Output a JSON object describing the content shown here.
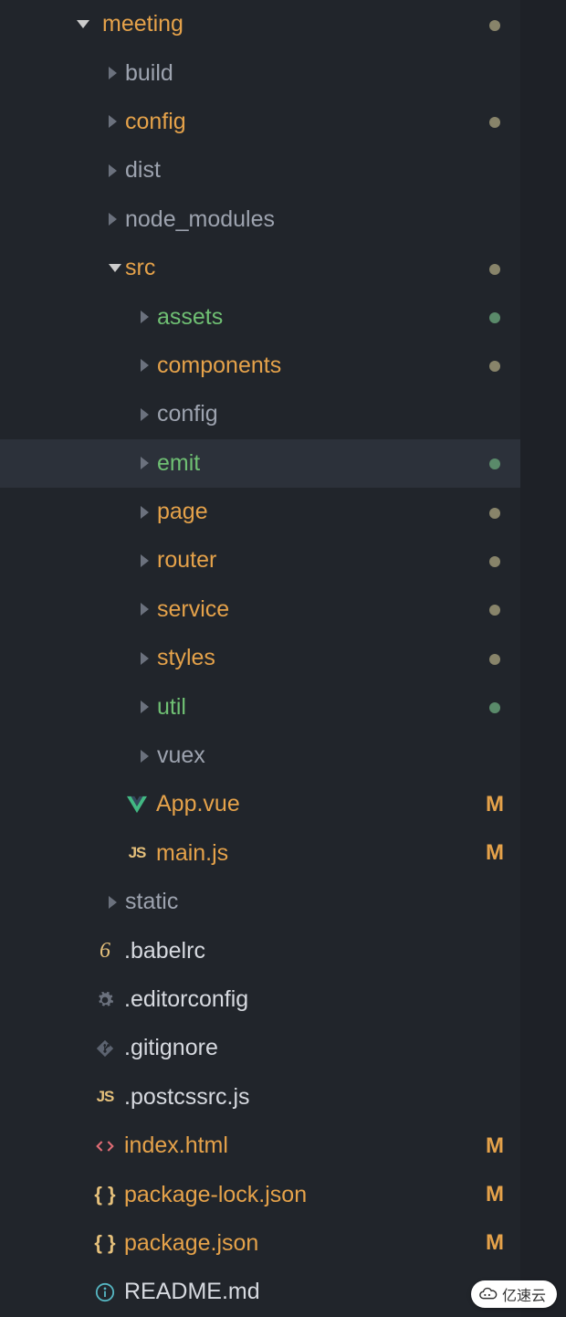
{
  "root": {
    "label": "meeting",
    "expanded": true,
    "status": "dot-tan"
  },
  "tree": [
    {
      "level": 1,
      "type": "folder",
      "label": "build",
      "color": "grey",
      "expanded": false,
      "status": ""
    },
    {
      "level": 1,
      "type": "folder",
      "label": "config",
      "color": "orange",
      "expanded": false,
      "status": "dot-tan"
    },
    {
      "level": 1,
      "type": "folder",
      "label": "dist",
      "color": "grey",
      "expanded": false,
      "status": ""
    },
    {
      "level": 1,
      "type": "folder",
      "label": "node_modules",
      "color": "grey",
      "expanded": false,
      "status": ""
    },
    {
      "level": 1,
      "type": "folder",
      "label": "src",
      "color": "orange",
      "expanded": true,
      "status": "dot-tan"
    },
    {
      "level": 2,
      "type": "folder",
      "label": "assets",
      "color": "green",
      "expanded": false,
      "status": "dot-green"
    },
    {
      "level": 2,
      "type": "folder",
      "label": "components",
      "color": "orange",
      "expanded": false,
      "status": "dot-tan"
    },
    {
      "level": 2,
      "type": "folder",
      "label": "config",
      "color": "grey",
      "expanded": false,
      "status": ""
    },
    {
      "level": 2,
      "type": "folder",
      "label": "emit",
      "color": "green",
      "expanded": false,
      "status": "dot-green",
      "selected": true
    },
    {
      "level": 2,
      "type": "folder",
      "label": "page",
      "color": "orange",
      "expanded": false,
      "status": "dot-tan"
    },
    {
      "level": 2,
      "type": "folder",
      "label": "router",
      "color": "orange",
      "expanded": false,
      "status": "dot-tan"
    },
    {
      "level": 2,
      "type": "folder",
      "label": "service",
      "color": "orange",
      "expanded": false,
      "status": "dot-tan"
    },
    {
      "level": 2,
      "type": "folder",
      "label": "styles",
      "color": "orange",
      "expanded": false,
      "status": "dot-tan"
    },
    {
      "level": 2,
      "type": "folder",
      "label": "util",
      "color": "green",
      "expanded": false,
      "status": "dot-green"
    },
    {
      "level": 2,
      "type": "folder",
      "label": "vuex",
      "color": "grey",
      "expanded": false,
      "status": ""
    },
    {
      "level": 2,
      "type": "file",
      "label": "App.vue",
      "color": "orange",
      "icon": "vue",
      "status": "M"
    },
    {
      "level": 2,
      "type": "file",
      "label": "main.js",
      "color": "orange",
      "icon": "js",
      "status": "M"
    },
    {
      "level": 1,
      "type": "folder",
      "label": "static",
      "color": "grey",
      "expanded": false,
      "status": ""
    },
    {
      "level": 1,
      "type": "file",
      "label": ".babelrc",
      "color": "white",
      "icon": "babel",
      "status": ""
    },
    {
      "level": 1,
      "type": "file",
      "label": ".editorconfig",
      "color": "white",
      "icon": "gear",
      "status": ""
    },
    {
      "level": 1,
      "type": "file",
      "label": ".gitignore",
      "color": "white",
      "icon": "git",
      "status": ""
    },
    {
      "level": 1,
      "type": "file",
      "label": ".postcssrc.js",
      "color": "white",
      "icon": "js",
      "status": ""
    },
    {
      "level": 1,
      "type": "file",
      "label": "index.html",
      "color": "orange",
      "icon": "html",
      "status": "M"
    },
    {
      "level": 1,
      "type": "file",
      "label": "package-lock.json",
      "color": "orange",
      "icon": "json",
      "status": "M"
    },
    {
      "level": 1,
      "type": "file",
      "label": "package.json",
      "color": "orange",
      "icon": "json",
      "status": "M"
    },
    {
      "level": 1,
      "type": "file",
      "label": "README.md",
      "color": "white",
      "icon": "info",
      "status": ""
    }
  ],
  "watermark": "亿速云"
}
